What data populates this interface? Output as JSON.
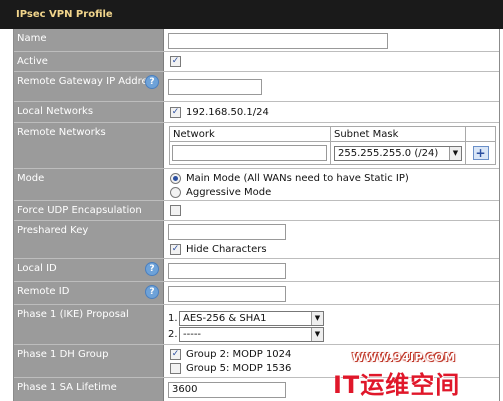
{
  "title": "IPsec VPN Profile",
  "rows": {
    "name": {
      "label": "Name",
      "value": ""
    },
    "active": {
      "label": "Active",
      "checked": true
    },
    "remote_gateway": {
      "label": "Remote Gateway IP Address",
      "value": ""
    },
    "local_networks": {
      "label": "Local Networks",
      "checked": true,
      "network": "192.168.50.1/24"
    },
    "remote_networks": {
      "label": "Remote Networks",
      "columns": [
        "Network",
        "Subnet Mask"
      ],
      "network_value": "",
      "subnet_selected": "255.255.255.0 (/24)",
      "add_icon": "plus-icon"
    },
    "mode": {
      "label": "Mode",
      "options": [
        "Main Mode (All WANs need to have Static IP)",
        "Aggressive Mode"
      ],
      "selected": "Main Mode (All WANs need to have Static IP)"
    },
    "force_udp": {
      "label": "Force UDP Encapsulation",
      "checked": false
    },
    "preshared_key": {
      "label": "Preshared Key",
      "value": "",
      "hide_label": "Hide Characters",
      "hide_checked": true
    },
    "local_id": {
      "label": "Local ID",
      "value": ""
    },
    "remote_id": {
      "label": "Remote ID",
      "value": ""
    },
    "phase1_proposal": {
      "label": "Phase 1 (IKE) Proposal",
      "items": [
        {
          "index": "1.",
          "selected": "AES-256 & SHA1"
        },
        {
          "index": "2.",
          "selected": "-----"
        }
      ]
    },
    "phase1_dh": {
      "label": "Phase 1 DH Group",
      "options": [
        {
          "text": "Group 2: MODP 1024",
          "checked": true
        },
        {
          "text": "Group 5: MODP 1536",
          "checked": false
        }
      ]
    },
    "phase1_sa": {
      "label": "Phase 1 SA Lifetime",
      "value": "3600"
    }
  },
  "watermark": {
    "line1": "WWW.94IP.COM",
    "line2": "IT运维空间"
  },
  "colors": {
    "title_bg": "#1a1a1a",
    "title_text": "#f1d58c",
    "label_bg": "#9b9b9b",
    "watermark": "#e0172a"
  }
}
